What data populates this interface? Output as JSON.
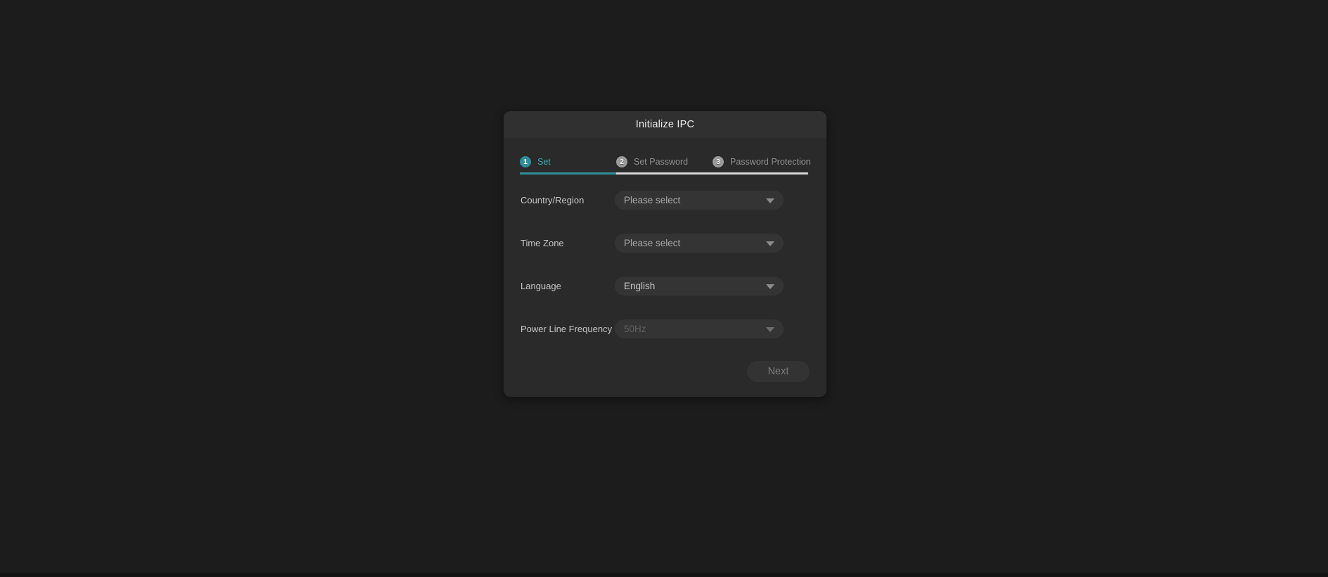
{
  "colors": {
    "accent": "#2f8e9c",
    "accent_text": "#3fa6b4",
    "page_bg": "#1c1c1c",
    "dialog_bg": "#2a2a2a",
    "titlebar_bg": "#303030",
    "progress_inactive": "#d7d7d7",
    "inactive_badge": "#9b9b9b"
  },
  "dialog": {
    "title": "Initialize IPC",
    "steps": [
      {
        "number": "1",
        "label": "Set",
        "state": "active"
      },
      {
        "number": "2",
        "label": "Set Password",
        "state": "inactive"
      },
      {
        "number": "3",
        "label": "Password Protection",
        "state": "inactive"
      }
    ],
    "active_step": 1,
    "fields": [
      {
        "label": "Country/Region",
        "value": "Please select",
        "state": "placeholder"
      },
      {
        "label": "Time Zone",
        "value": "Please select",
        "state": "placeholder"
      },
      {
        "label": "Language",
        "value": "English",
        "state": "selected"
      },
      {
        "label": "Power Line Frequency",
        "value": "50Hz",
        "state": "disabled"
      }
    ],
    "next_label": "Next"
  }
}
